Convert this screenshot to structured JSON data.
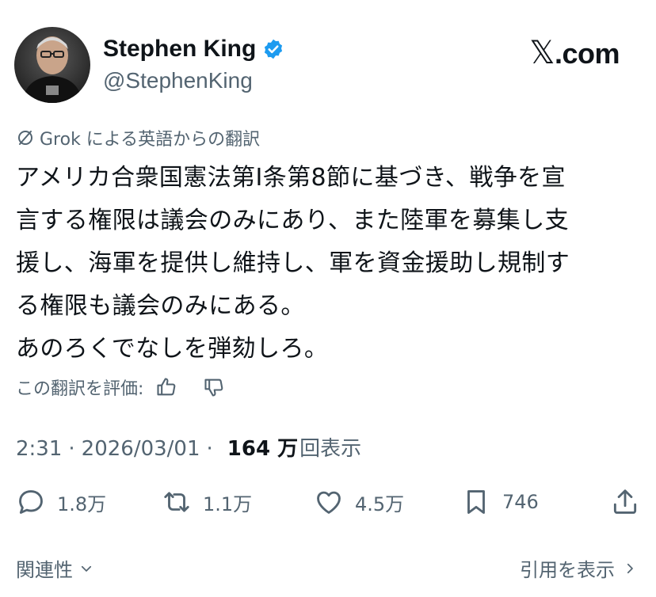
{
  "author": {
    "display_name": "Stephen King",
    "handle": "@StephenKing"
  },
  "brand": {
    "label": ".com",
    "x_glyph": "𝕏"
  },
  "translation": {
    "note": "Grok による英語からの翻訳",
    "icon": "grok-icon"
  },
  "tweet": {
    "lines": [
      "アメリカ合衆国憲法第I条第8節に基づき、戦争を宣",
      "言する権限は議会のみにあり、また陸軍を募集し支",
      "援し、海軍を提供し維持し、軍を資金援助し規制す",
      "る権限も議会のみにある。",
      "あのろくでなしを弾劾しろ。"
    ]
  },
  "rate_translation": {
    "label": "この翻訳を評価:"
  },
  "meta": {
    "time": "2:31",
    "separator": "·",
    "date": "2026/03/01",
    "views_count": "164 万",
    "views_label": "回表示"
  },
  "actions": {
    "replies": "1.8万",
    "reposts": "1.1万",
    "likes": "4.5万",
    "bookmarks": "746"
  },
  "footer": {
    "related": "関連性",
    "quotes": "引用を表示"
  },
  "colors": {
    "text": "#0f1419",
    "secondary": "#536471",
    "verified": "#1d9bf0"
  }
}
